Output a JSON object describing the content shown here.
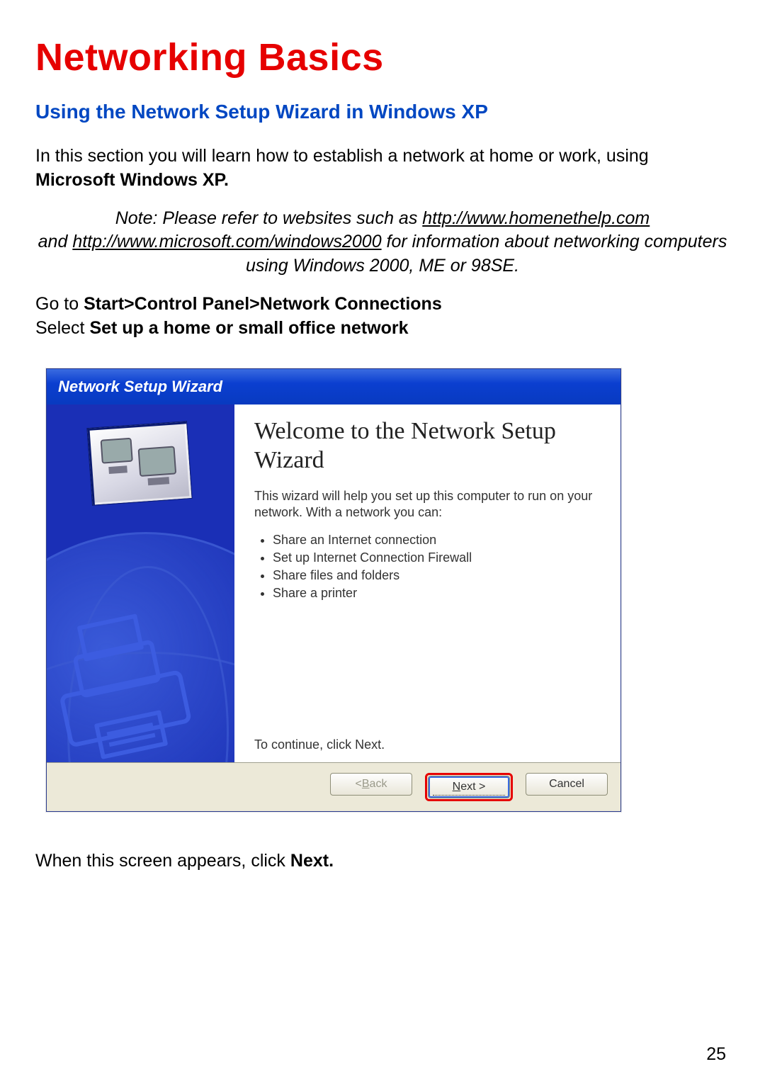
{
  "doc": {
    "title": "Networking Basics",
    "subtitle": "Using the Network Setup Wizard in Windows XP",
    "intro_pre": "In this section you will learn how to establish a network at home or work, using ",
    "intro_bold": "Microsoft Windows XP.",
    "note_pre": "Note:  Please refer to websites such as ",
    "note_link1": "http://www.homenethelp.com",
    "note_mid": "and ",
    "note_link2": "http://www.microsoft.com/windows2000",
    "note_post": "  for information about networking computers using Windows 2000, ME or 98SE.",
    "goto_pre": "Go to ",
    "goto_bold": "Start>Control Panel>Network Connections",
    "select_pre": "Select ",
    "select_bold": "Set up a home or small office network",
    "after_pre": "When this screen appears, click ",
    "after_bold": "Next.",
    "page_number": "25"
  },
  "wizard": {
    "titlebar": "Network Setup Wizard",
    "welcome": "Welcome to the Network Setup Wizard",
    "intro": "This wizard will help you set up this computer to run on your network. With a network you can:",
    "bullets": [
      "Share an Internet connection",
      "Set up Internet Connection Firewall",
      "Share files and folders",
      "Share a printer"
    ],
    "continue": "To continue, click Next.",
    "buttons": {
      "back_prefix": "< ",
      "back_u": "B",
      "back_rest": "ack",
      "next_u": "N",
      "next_rest": "ext >",
      "cancel": "Cancel"
    }
  }
}
